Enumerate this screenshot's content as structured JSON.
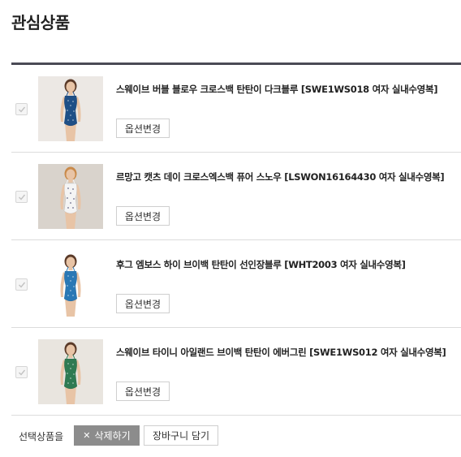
{
  "page": {
    "title": "관심상품"
  },
  "items": [
    {
      "name": "스웨이브 버블 블로우 크로스백 탄탄이 다크블루 [SWE1WS018 여자 실내수영복]",
      "option_label": "옵션변경",
      "checked": true,
      "swimsuit_color": "#1f4f86",
      "background_color": "#ece8e4"
    },
    {
      "name": "르망고 캣츠 데이 크로스엑스백 퓨어 스노우 [LSWON16164430 여자 실내수영복]",
      "option_label": "옵션변경",
      "checked": true,
      "swimsuit_color": "#f4f4f4",
      "background_color": "#d9d3cc"
    },
    {
      "name": "후그 엠보스 하이 브이백 탄탄이 선인장블루 [WHT2003 여자 실내수영복]",
      "option_label": "옵션변경",
      "checked": true,
      "swimsuit_color": "#2a78b5",
      "background_color": "#ffffff"
    },
    {
      "name": "스웨이브 타이니 아일랜드 브이백 탄탄이 에버그린 [SWE1WS012 여자 실내수영복]",
      "option_label": "옵션변경",
      "checked": true,
      "swimsuit_color": "#2f7a52",
      "background_color": "#e9e5df"
    }
  ],
  "footer": {
    "selected_label": "선택상품을",
    "delete_label": "삭제하기",
    "delete_icon": "close-icon",
    "cart_label": "장바구니 담기"
  }
}
